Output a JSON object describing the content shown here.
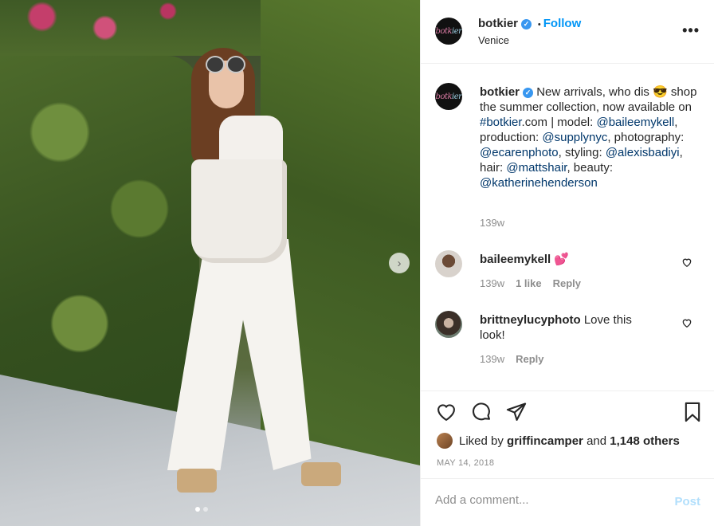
{
  "post": {
    "username": "botkier",
    "follow_label": "Follow",
    "separator": "•",
    "location": "Venice",
    "more_label": "•••",
    "avatar_logo_a": "botk",
    "avatar_logo_b": "ier"
  },
  "caption": {
    "username": "botkier",
    "text_1": "New arrivals, who dis 😎 shop the summer collection, now available on ",
    "hashtag": "#botkier",
    "text_2": ".com | model: ",
    "mention_1": "@baileemykell",
    "text_3": ", production: ",
    "mention_2": "@supplynyc",
    "text_4": ", photography: ",
    "mention_3": "@ecarenphoto",
    "text_5": ", styling: ",
    "mention_4": "@alexisbadiyi",
    "text_6": ", hair: ",
    "mention_5": "@mattshair",
    "text_7": ", beauty: ",
    "mention_6": "@katherinehenderson",
    "time": "139w"
  },
  "comments": [
    {
      "username": "baileemykell",
      "text": "💕",
      "time": "139w",
      "likes": "1 like",
      "reply": "Reply"
    },
    {
      "username": "brittneylucyphoto",
      "text": "Love this look!",
      "time": "139w",
      "reply": "Reply"
    }
  ],
  "actions": {
    "liked_prefix": "Liked by",
    "liked_user": "griffincamper",
    "liked_and": "and",
    "liked_others": "1,148 others",
    "date": "MAY 14, 2018"
  },
  "add_comment": {
    "placeholder": "Add a comment...",
    "post_label": "Post"
  },
  "carousel": {
    "next_label": "›",
    "slide_count": 2,
    "active_index": 1
  },
  "colors": {
    "accent": "#0095f6",
    "verified": "#3897f0",
    "link": "#00376b",
    "muted": "#8e8e8e",
    "post_disabled": "#b2dffc"
  },
  "icons": [
    "heart-icon",
    "comment-icon",
    "share-icon",
    "bookmark-icon",
    "more-icon",
    "verified-icon",
    "chevron-right-icon"
  ]
}
